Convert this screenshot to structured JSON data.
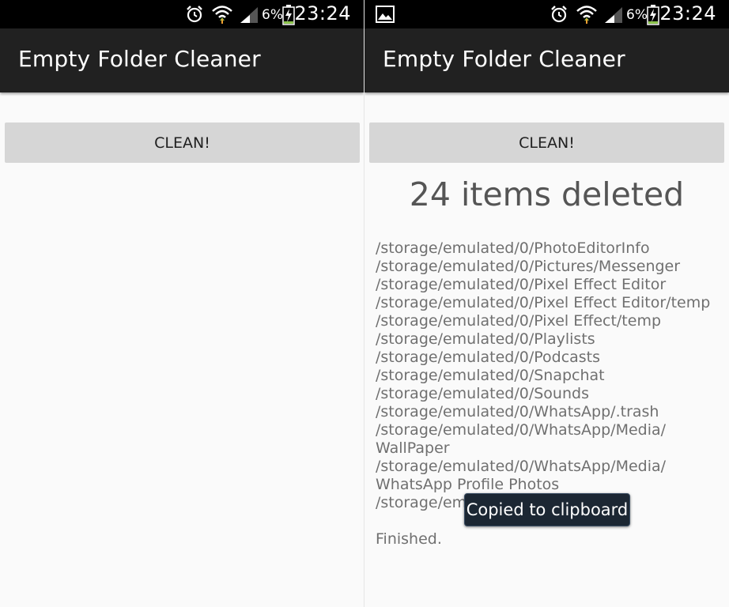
{
  "left_screen": {
    "status_bar": {
      "battery": "6%",
      "time": "23:24",
      "icons": [
        "alarm-icon",
        "wifi-icon",
        "signal-icon",
        "battery-charging-icon"
      ]
    },
    "app_title": "Empty Folder Cleaner",
    "clean_button": "CLEAN!"
  },
  "right_screen": {
    "status_bar": {
      "battery": "6%",
      "time": "23:24",
      "icons": [
        "image-notification-icon",
        "alarm-icon",
        "wifi-icon",
        "signal-icon",
        "battery-charging-icon"
      ]
    },
    "app_title": "Empty Folder Cleaner",
    "clean_button": "CLEAN!",
    "result_title": "24 items deleted",
    "log_lines": [
      "/storage/emulated/0/PhotoEditorInfo",
      "/storage/emulated/0/Pictures/Messenger",
      "/storage/emulated/0/Pixel Effect Editor",
      "/storage/emulated/0/Pixel Effect Editor/temp",
      "/storage/emulated/0/Pixel Effect/temp",
      "/storage/emulated/0/Playlists",
      "/storage/emulated/0/Podcasts",
      "/storage/emulated/0/Snapchat",
      "/storage/emulated/0/Sounds",
      "/storage/emulated/0/WhatsApp/.trash",
      "/storage/emulated/0/WhatsApp/Media/",
      "WallPaper",
      "/storage/emulated/0/WhatsApp/Media/",
      "WhatsApp Profile Photos",
      "/storage/em"
    ],
    "finished_text": "Finished.",
    "toast": "Copied to clipboard"
  },
  "colors": {
    "status_bar": "#000000",
    "action_bar": "#212121",
    "background": "#fafafa",
    "button": "#d6d6d6",
    "toast": "#1c2733",
    "charging": "#8bc34a"
  }
}
